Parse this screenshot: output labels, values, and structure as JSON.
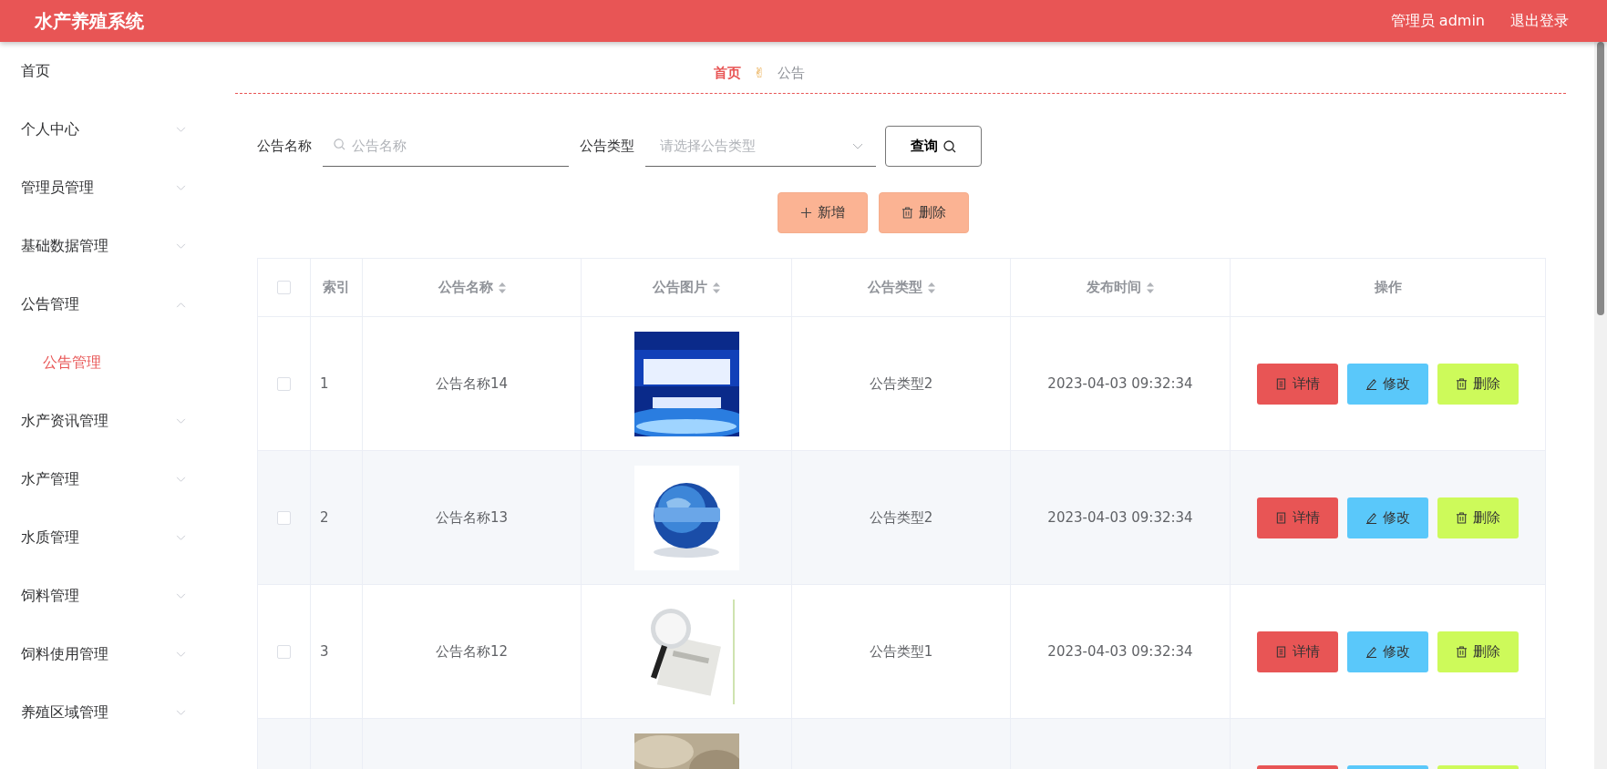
{
  "header": {
    "title": "水产养殖系统",
    "user": "管理员 admin",
    "logout": "退出登录"
  },
  "sidebar": {
    "items": [
      {
        "label": "首页",
        "kind": "link",
        "selected": false
      },
      {
        "label": "个人中心",
        "kind": "submenu",
        "expanded": false,
        "selected": false
      },
      {
        "label": "管理员管理",
        "kind": "submenu",
        "expanded": false,
        "selected": false
      },
      {
        "label": "基础数据管理",
        "kind": "submenu",
        "expanded": false,
        "selected": false
      },
      {
        "label": "公告管理",
        "kind": "submenu",
        "expanded": true,
        "selected": false,
        "children": [
          {
            "label": "公告管理",
            "selected": true
          }
        ]
      },
      {
        "label": "水产资讯管理",
        "kind": "submenu",
        "expanded": false,
        "selected": false
      },
      {
        "label": "水产管理",
        "kind": "submenu",
        "expanded": false,
        "selected": false
      },
      {
        "label": "水质管理",
        "kind": "submenu",
        "expanded": false,
        "selected": false
      },
      {
        "label": "饲料管理",
        "kind": "submenu",
        "expanded": false,
        "selected": false
      },
      {
        "label": "饲料使用管理",
        "kind": "submenu",
        "expanded": false,
        "selected": false
      },
      {
        "label": "养殖区域管理",
        "kind": "submenu",
        "expanded": false,
        "selected": false
      }
    ]
  },
  "breadcrumb": {
    "separator": "✌",
    "items": [
      {
        "label": "首页",
        "selected": true
      },
      {
        "label": "公告",
        "selected": false
      }
    ]
  },
  "filters": {
    "name_label": "公告名称",
    "name_placeholder": "公告名称",
    "type_label": "公告类型",
    "type_placeholder": "请选择公告类型",
    "query": "查询"
  },
  "toolbar": [
    {
      "label": "新增",
      "kind": "add"
    },
    {
      "label": "删除",
      "kind": "delete"
    }
  ],
  "table": {
    "select_all": {
      "checked": false
    },
    "columns": [
      {
        "label": "索引",
        "sortable": false
      },
      {
        "label": "公告名称",
        "sortable": true
      },
      {
        "label": "公告图片",
        "sortable": true
      },
      {
        "label": "公告类型",
        "sortable": true
      },
      {
        "label": "发布时间",
        "sortable": true
      },
      {
        "label": "操作",
        "sortable": false
      }
    ],
    "rows": [
      {
        "checked": false,
        "index": "1",
        "name": "公告名称14",
        "image": {
          "kind": "picture"
        },
        "type": "公告类型2",
        "time": "2023-04-03 09:32:34",
        "actions": [
          {
            "label": "详情",
            "kind": "detail"
          },
          {
            "label": "修改",
            "kind": "edit"
          },
          {
            "label": "删除",
            "kind": "delete"
          }
        ]
      },
      {
        "checked": false,
        "index": "2",
        "name": "公告名称13",
        "image": {
          "kind": "picture"
        },
        "type": "公告类型2",
        "time": "2023-04-03 09:32:34",
        "actions": [
          {
            "label": "详情",
            "kind": "detail"
          },
          {
            "label": "修改",
            "kind": "edit"
          },
          {
            "label": "删除",
            "kind": "delete"
          }
        ]
      },
      {
        "checked": false,
        "index": "3",
        "name": "公告名称12",
        "image": {
          "kind": "picture"
        },
        "type": "公告类型1",
        "time": "2023-04-03 09:32:34",
        "actions": [
          {
            "label": "详情",
            "kind": "detail"
          },
          {
            "label": "修改",
            "kind": "edit"
          },
          {
            "label": "删除",
            "kind": "delete"
          }
        ]
      },
      {
        "image": {
          "kind": "picture"
        },
        "actions": [
          {
            "kind": "detail"
          },
          {
            "kind": "edit"
          },
          {
            "kind": "delete"
          }
        ]
      }
    ]
  }
}
